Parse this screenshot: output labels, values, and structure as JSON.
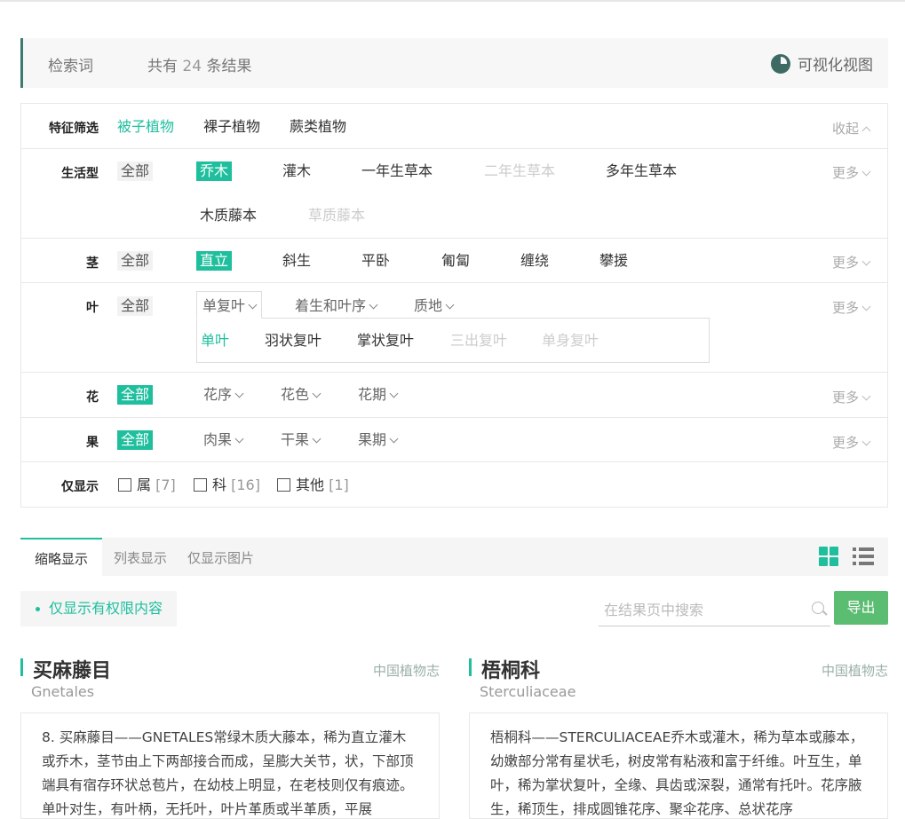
{
  "summary": {
    "keyword_label": "检索词",
    "count_prefix": "共有",
    "count": "24",
    "count_suffix": "条结果",
    "viz_label": "可视化视图"
  },
  "filters": {
    "feature": {
      "label": "特征筛选",
      "options": [
        "被子植物",
        "裸子植物",
        "蕨类植物"
      ],
      "collapse": "收起"
    },
    "lifeform": {
      "label": "生活型",
      "all": "全部",
      "options": [
        "乔木",
        "灌木",
        "一年生草本",
        "二年生草本",
        "多年生草本",
        "木质藤本",
        "草质藤本"
      ],
      "more": "更多"
    },
    "stem": {
      "label": "茎",
      "all": "全部",
      "options": [
        "直立",
        "斜生",
        "平卧",
        "匍匐",
        "缠绕",
        "攀援"
      ],
      "more": "更多"
    },
    "leaf": {
      "label": "叶",
      "all": "全部",
      "dropdowns": [
        "单复叶",
        "着生和叶序",
        "质地"
      ],
      "sub_options": [
        "单叶",
        "羽状复叶",
        "掌状复叶",
        "三出复叶",
        "单身复叶"
      ],
      "more": "更多"
    },
    "flower": {
      "label": "花",
      "all": "全部",
      "dropdowns": [
        "花序",
        "花色",
        "花期"
      ],
      "more": "更多"
    },
    "fruit": {
      "label": "果",
      "all": "全部",
      "dropdowns": [
        "肉果",
        "干果",
        "果期"
      ],
      "more": "更多"
    },
    "only": {
      "label": "仅显示",
      "items": [
        {
          "name": "属",
          "count": "[7]"
        },
        {
          "name": "科",
          "count": "[16]"
        },
        {
          "name": "其他",
          "count": "[1]"
        }
      ]
    }
  },
  "view_tabs": [
    "缩略显示",
    "列表显示",
    "仅显示图片"
  ],
  "toolbar": {
    "perm_label": "仅显示有权限内容",
    "search_placeholder": "在结果页中搜索",
    "export_label": "导出"
  },
  "results": [
    {
      "title": "买麻藤目",
      "source": "中国植物志",
      "latin": "Gnetales",
      "text": "8. 买麻藤目——GNETALES常绿木质大藤本，稀为直立灌木或乔木，茎节由上下两部接合而成，呈膨大关节，状，下部顶端具有宿存环状总苞片，在幼枝上明显，在老枝则仅有痕迹。单叶对生，有叶柄，无托叶，叶片革质或半革质，平展"
    },
    {
      "title": "梧桐科",
      "source": "中国植物志",
      "latin": "Sterculiaceae",
      "text": "梧桐科——STERCULIACEAE乔木或灌木，稀为草本或藤本，幼嫩部分常有星状毛，树皮常有粘液和富于纤维。叶互生，单叶，稀为掌状复叶，全缘、具齿或深裂，通常有托叶。花序腋生，稀顶生，排成圆锥花序、聚伞花序、总状花序"
    }
  ],
  "colors": {
    "accent": "#1fbf9e",
    "export": "#5bbd72",
    "summary_border": "#3d7a6f"
  }
}
